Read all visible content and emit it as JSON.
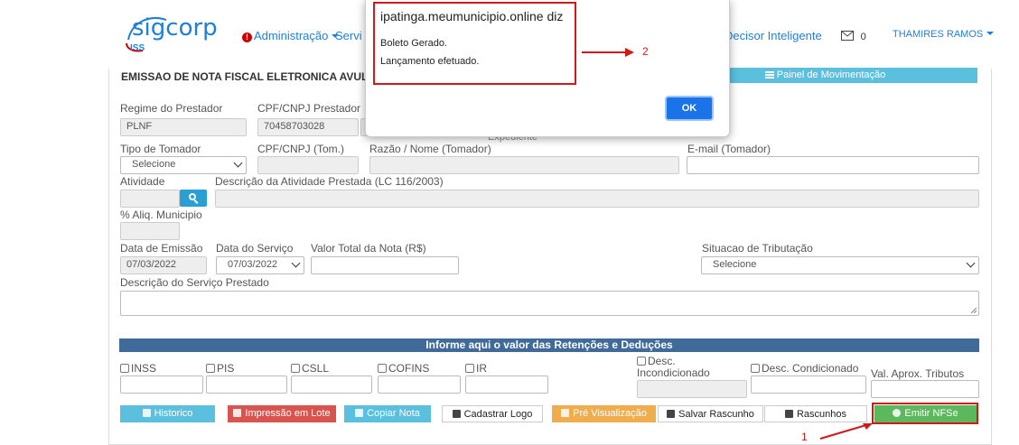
{
  "navbar": {
    "logo_text": "sigcorp",
    "logo_sub": "ISS",
    "admin_badge": "!",
    "admin_label": "Administração",
    "servicos_label": "Servi",
    "decisor_label": "Decisor Inteligente",
    "mail_count": "0",
    "user_name": "THAMIRES RAMOS"
  },
  "panel": {
    "title": "EMISSAO DE NOTA FISCAL ELETRONICA AVULSA",
    "movimentacao_label": "Painel de Movimentação",
    "expediente_partial": "Expediente"
  },
  "form": {
    "regime_label": "Regime do Prestador",
    "regime_value": "PLNF",
    "cpf_prestador_label": "CPF/CNPJ Prestador",
    "cpf_prestador_value": "70458703028",
    "tipo_tomador_label": "Tipo de Tomador",
    "tipo_tomador_value": "Selecione",
    "cpf_tomador_label": "CPF/CNPJ (Tom.)",
    "razao_label": "Razão / Nome (Tomador)",
    "email_label": "E-mail (Tomador)",
    "atividade_label": "Atividade",
    "descricao_atividade_label": "Descrição da Atividade Prestada (LC 116/2003)",
    "aliq_label": "% Aliq. Municipio",
    "data_emissao_label": "Data de Emissão",
    "data_emissao_value": "07/03/2022",
    "data_servico_label": "Data do Serviço",
    "data_servico_value": "07/03/2022",
    "valor_total_label": "Valor Total da Nota (R$)",
    "situacao_label": "Situacao de Tributação",
    "situacao_value": "Selecione",
    "descricao_servico_label": "Descrição do Serviço Prestado"
  },
  "retencoes": {
    "header": "Informe aqui o valor das Retenções e Deduções",
    "inss": "INSS",
    "pis": "PIS",
    "csll": "CSLL",
    "cofins": "COFINS",
    "ir": "IR",
    "desc_incond_1": "Desc.",
    "desc_incond_2": "Incondicionado",
    "desc_cond": "Desc. Condicionado",
    "val_aprox": "Val. Aprox. Tributos"
  },
  "buttons": {
    "historico": "Historico",
    "impressao_lote": "Impressão em Lote",
    "copiar_nota": "Copiar Nota",
    "cadastrar_logo": "Cadastrar Logo",
    "pre_visualizacao": "Pré Visualização",
    "salvar_rascunho": "Salvar Rascunho",
    "rascunhos": "Rascunhos",
    "emitir_nfse": "Emitir NFSe"
  },
  "dialog": {
    "title": "ipatinga.meumunicipio.online diz",
    "line1": "Boleto Gerado.",
    "line2": "Lançamento efetuado.",
    "ok_label": "OK"
  },
  "annotations": {
    "label_1": "1",
    "label_2": "2"
  },
  "colors": {
    "brand": "#1f7fd6",
    "info_button": "#5bc0de",
    "section_bar": "#3f6a9a",
    "danger_button": "#d9534f",
    "warning_button": "#f0ad4e",
    "success_button": "#5cb85c",
    "annotation_red": "#d01a1a"
  }
}
